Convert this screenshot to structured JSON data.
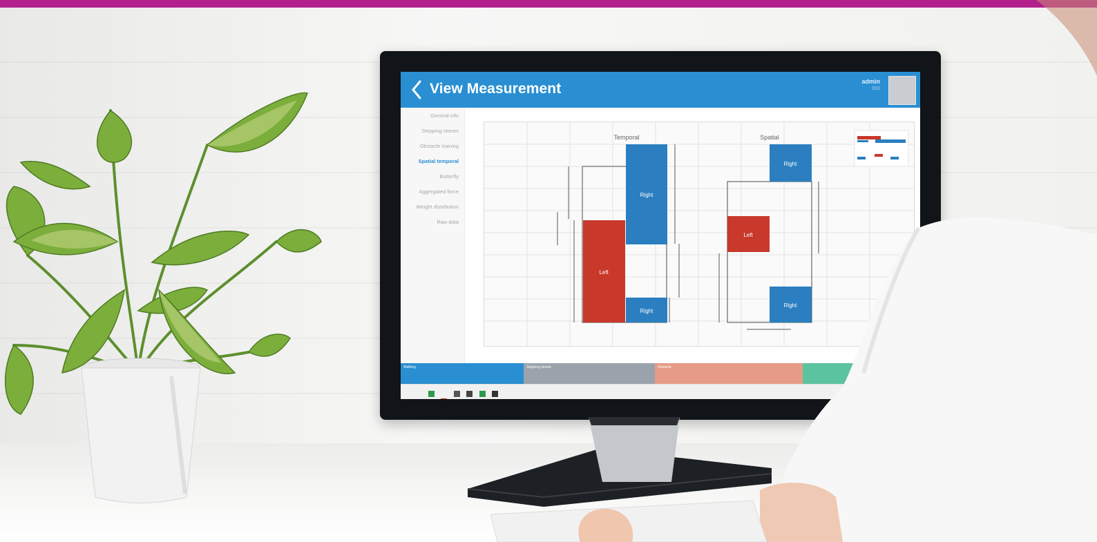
{
  "app": {
    "title": "View Measurement",
    "user": {
      "name": "admin",
      "id": "002"
    }
  },
  "nav": {
    "items": [
      {
        "label": "General info",
        "active": false
      },
      {
        "label": "Stepping stones",
        "active": false
      },
      {
        "label": "Obstacle training",
        "active": false
      },
      {
        "label": "Spatial temporal",
        "active": true
      },
      {
        "label": "Butterfly",
        "active": false
      },
      {
        "label": "Aggregated force",
        "active": false
      },
      {
        "label": "Weight distribution",
        "active": false
      },
      {
        "label": "Raw data",
        "active": false
      }
    ]
  },
  "chart_data": {
    "type": "bar",
    "panels": [
      {
        "title": "Temporal",
        "bars": [
          "Left",
          "Right",
          "Right"
        ]
      },
      {
        "title": "Spatial",
        "bars": [
          "Right",
          "Left",
          "Right"
        ]
      }
    ],
    "grid": true
  },
  "status": {
    "segments": [
      {
        "label": "Walking",
        "color": "#2a8fd2"
      },
      {
        "label": "Stepping stones",
        "color": "#9aa3ab"
      },
      {
        "label": "Obstacle",
        "color": "#e59b86"
      },
      {
        "label": "",
        "color": "#5cc3a0"
      }
    ]
  },
  "colors": {
    "accent": "#2a8fd2",
    "left_bar": "#c8382b",
    "right_bar": "#2b7fc0",
    "brand_bar": "#b41f8e"
  }
}
